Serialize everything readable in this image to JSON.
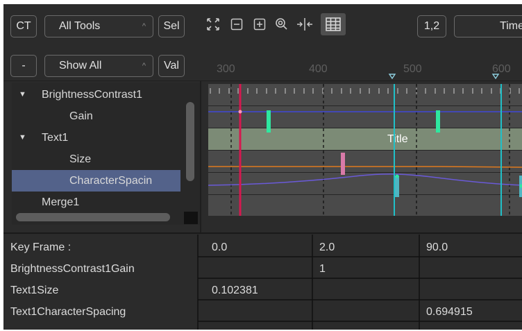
{
  "toolbar": {
    "ct_label": "CT",
    "tools_dropdown": "All Tools",
    "sel_label": "Sel",
    "minus_label": "-",
    "show_dropdown": "Show All",
    "val_label": "Val",
    "number_label": "1,2",
    "time_label": "Time",
    "icons": [
      "fit-icon",
      "zoom-out-icon",
      "zoom-in-icon",
      "zoom-magnifier-icon",
      "split-icon",
      "spreadsheet-icon"
    ]
  },
  "ruler": {
    "labels": [
      "300",
      "400",
      "500",
      "600"
    ]
  },
  "tree": {
    "items": [
      {
        "label": "BrightnessContrast1",
        "expanded": true
      },
      {
        "label": "Gain"
      },
      {
        "label": "Text1",
        "expanded": true
      },
      {
        "label": "Size"
      },
      {
        "label": "CharacterSpacin",
        "selected": true
      },
      {
        "label": "Merge1"
      }
    ]
  },
  "timeline": {
    "title_bar_label": "Title"
  },
  "keyframes": {
    "header": "Key Frame :",
    "columns": [
      "0.0",
      "2.0",
      "90.0"
    ],
    "rows": [
      {
        "name": "BrightnessContrast1Gain",
        "values": [
          "",
          "1",
          ""
        ]
      },
      {
        "name": "Text1Size",
        "values": [
          "0.102381",
          "",
          ""
        ]
      },
      {
        "name": "Text1CharacterSpacing",
        "values": [
          "",
          "",
          "0.694915"
        ]
      }
    ]
  },
  "colors": {
    "panel": "#2b2b2b",
    "selection": "#53628a",
    "playhead": "#d6184f",
    "cyan": "#20c0c8",
    "green_key": "#2ee8a0",
    "pink_key": "#d87aa8"
  }
}
